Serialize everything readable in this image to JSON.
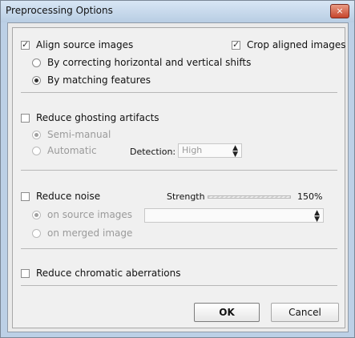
{
  "window": {
    "title": "Preprocessing Options",
    "close_label": "×"
  },
  "align": {
    "label": "Align source images",
    "checked": true,
    "crop_label": "Crop aligned images",
    "crop_checked": true,
    "options": [
      {
        "label": "By correcting horizontal and vertical shifts",
        "selected": false
      },
      {
        "label": "By matching features",
        "selected": true
      }
    ]
  },
  "ghosting": {
    "label": "Reduce ghosting artifacts",
    "checked": false,
    "options": [
      {
        "label": "Semi-manual",
        "selected": true
      },
      {
        "label": "Automatic",
        "selected": false
      }
    ],
    "detection_label": "Detection:",
    "detection_value": "High"
  },
  "noise": {
    "label": "Reduce noise",
    "checked": false,
    "strength_label": "Strength",
    "strength_value": "150%",
    "options": [
      {
        "label": "on source images",
        "selected": true
      },
      {
        "label": "on merged image",
        "selected": false
      }
    ],
    "source_select_value": ""
  },
  "chromatic": {
    "label": "Reduce chromatic aberrations",
    "checked": false
  },
  "buttons": {
    "ok": "OK",
    "cancel": "Cancel"
  },
  "colors": {
    "titlebar": "#c6d8ec",
    "panel": "#f0f0f0",
    "disabled_text": "#9a9a9a"
  }
}
